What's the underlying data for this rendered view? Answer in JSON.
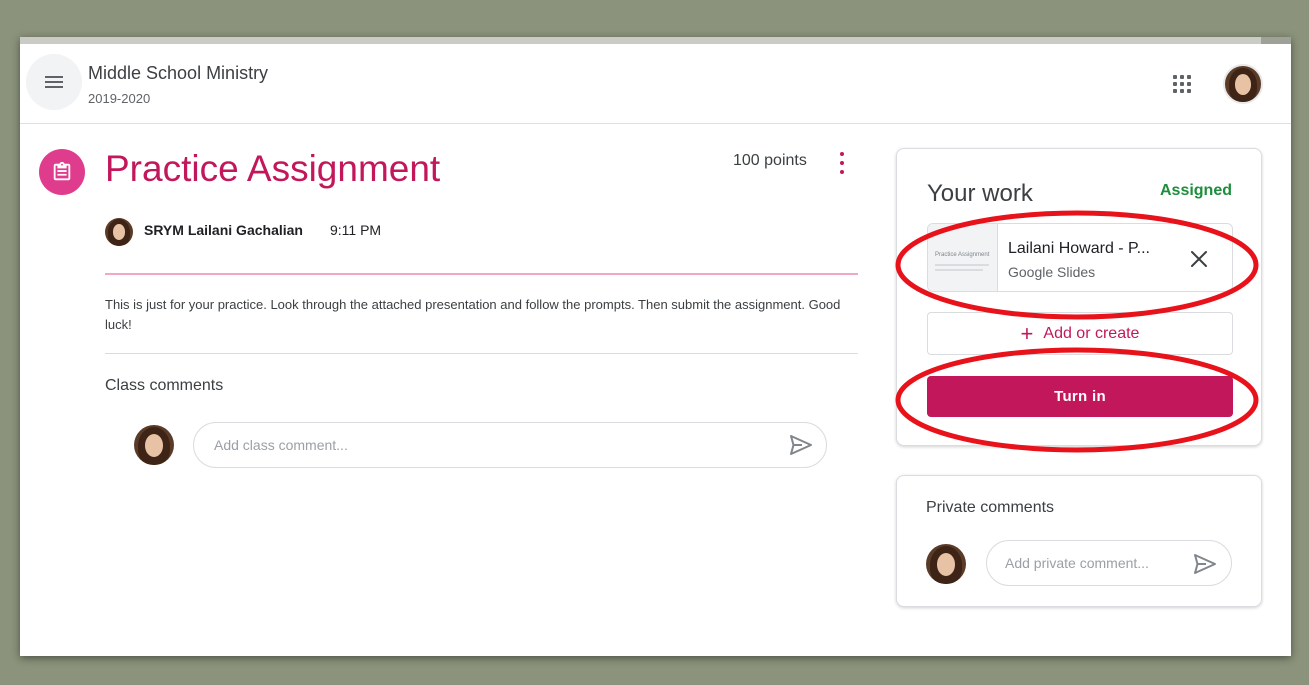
{
  "header": {
    "class_name": "Middle School Ministry",
    "class_term": "2019-2020",
    "menu_icon": "hamburger-menu-icon",
    "apps_icon": "google-apps-grid-icon"
  },
  "assignment": {
    "title": "Practice Assignment",
    "points": "100 points",
    "author": "SRYM Lailani Gachalian",
    "time": "9:11 PM",
    "description": "This is just for your practice. Look through the attached presentation and follow the prompts. Then submit the assignment. Good luck!",
    "class_comments_label": "Class comments",
    "class_comment_placeholder": "Add class comment..."
  },
  "your_work": {
    "title": "Your work",
    "status": "Assigned",
    "attachment": {
      "name": "Lailani Howard - P...",
      "type": "Google Slides",
      "thumbnail_title": "Practice Assignment"
    },
    "add_label": "Add or create",
    "turn_in_label": "Turn in"
  },
  "private_comments": {
    "title": "Private comments",
    "placeholder": "Add private comment..."
  },
  "colors": {
    "accent": "#c2185b",
    "status_green": "#1e8e3e",
    "annotation_red": "#e8121b"
  }
}
